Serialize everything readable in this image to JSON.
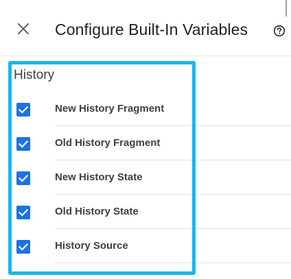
{
  "header": {
    "title": "Configure Built-In Variables",
    "close_icon": "close-icon",
    "help_icon": "help-circle-icon"
  },
  "section": {
    "title": "History",
    "highlight_color": "#1ab6ea",
    "checkbox_color": "#1a73e8",
    "items": [
      {
        "label": "New History Fragment",
        "checked": true
      },
      {
        "label": "Old History Fragment",
        "checked": true
      },
      {
        "label": "New History State",
        "checked": true
      },
      {
        "label": "Old History State",
        "checked": true
      },
      {
        "label": "History Source",
        "checked": true
      }
    ]
  }
}
